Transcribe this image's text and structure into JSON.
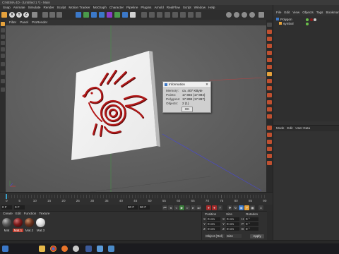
{
  "window": {
    "title": "CINEMA 4D - [Untitled 1 *] - Main"
  },
  "menu": [
    "Snap",
    "Animate",
    "Simulate",
    "Render",
    "Sculpt",
    "Motion Tracker",
    "MoGraph",
    "Character",
    "Pipeline",
    "Plugins",
    "Arnold",
    "RealFlow",
    "Script",
    "Window",
    "Help"
  ],
  "toolbar": {
    "axis": [
      "X",
      "Y",
      "Z"
    ]
  },
  "viewport": {
    "menu": [
      "Filter",
      "Panel",
      "ProRender"
    ]
  },
  "object_manager": {
    "menu": [
      "File",
      "Edit",
      "View",
      "Objects",
      "Tags",
      "Bookmarks"
    ],
    "objects": [
      {
        "name": "Polygon"
      },
      {
        "name": "symbol"
      }
    ]
  },
  "attributes": {
    "menu": [
      "Mode",
      "Edit",
      "User Data"
    ]
  },
  "info_dialog": {
    "title": "Information",
    "rows": [
      {
        "label": "Memory:",
        "value": "ca. 407 KByte"
      },
      {
        "label": "Points:",
        "value": "17 894 (17 894)"
      },
      {
        "label": "Polygons:",
        "value": "17 898 (17 897)"
      },
      {
        "label": "Objects:",
        "value": "2 (1)"
      }
    ],
    "ok": "OK"
  },
  "timeline": {
    "ticks": [
      "0",
      "5",
      "10",
      "15",
      "20",
      "25",
      "30",
      "35",
      "40",
      "45",
      "50",
      "55",
      "60",
      "65",
      "70",
      "75",
      "80",
      "85",
      "90"
    ],
    "start": "0 F",
    "current": "0 F",
    "end": "90 F",
    "end_max": "90 F",
    "frame_label": "0 F"
  },
  "materials": {
    "menu": [
      "Create",
      "Edit",
      "Function",
      "Texture"
    ],
    "items": [
      {
        "name": "Mat",
        "color": "#5a5a5a"
      },
      {
        "name": "Mat.1",
        "color": "#7a1a1a",
        "selected": true
      },
      {
        "name": "Mat.2",
        "color": "#6b3420"
      },
      {
        "name": "Mat.3",
        "color": "#e8e8e8"
      }
    ]
  },
  "coordinates": {
    "headers": [
      "Position",
      "Size",
      "Rotation"
    ],
    "rows": [
      {
        "axis": "X",
        "pos": "0 cm",
        "size_axis": "X",
        "size": "0 cm",
        "rot_axis": "H",
        "rot": "0 °"
      },
      {
        "axis": "Y",
        "pos": "0 cm",
        "size_axis": "Y",
        "size": "0 cm",
        "rot_axis": "P",
        "rot": "0 °"
      },
      {
        "axis": "Z",
        "pos": "0 cm",
        "size_axis": "Z",
        "size": "0 cm",
        "rot_axis": "B",
        "rot": "0 °"
      }
    ],
    "mode": "Object (Rel)",
    "size_mode": "Size",
    "apply": "Apply"
  },
  "icons": {
    "playback": [
      "first-frame-icon",
      "prev-key-icon",
      "prev-frame-icon",
      "play-icon",
      "next-frame-icon",
      "next-key-icon",
      "last-frame-icon"
    ],
    "taskbar": [
      "start-icon",
      "folder-icon",
      "chrome-icon",
      "firefox-icon",
      "cinema4d-icon",
      "media-icon",
      "explorer-icon",
      "app-icon"
    ]
  },
  "colors": {
    "accent": "#e6a23c",
    "viewport_bg": "#5e5e5e",
    "axis_y": "#4a8a4a",
    "axis_x": "#c04040",
    "axis_z": "#4a4ac8",
    "emblem_red": "#a51515",
    "selection": "#c23a2a"
  }
}
